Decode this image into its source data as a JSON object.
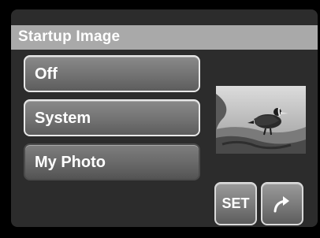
{
  "header": {
    "title": "Startup Image"
  },
  "menu": {
    "items": [
      {
        "label": "Off"
      },
      {
        "label": "System"
      },
      {
        "label": "My Photo"
      }
    ],
    "selected": "My Photo"
  },
  "preview": {
    "icon": "bird-photo-thumbnail"
  },
  "buttons": {
    "set_label": "SET",
    "back_icon": "return-arrow-icon"
  },
  "colors": {
    "title_bar": "#a9a9a9",
    "panel": "#2c2c2c",
    "item_border": "#e8e8e8"
  }
}
